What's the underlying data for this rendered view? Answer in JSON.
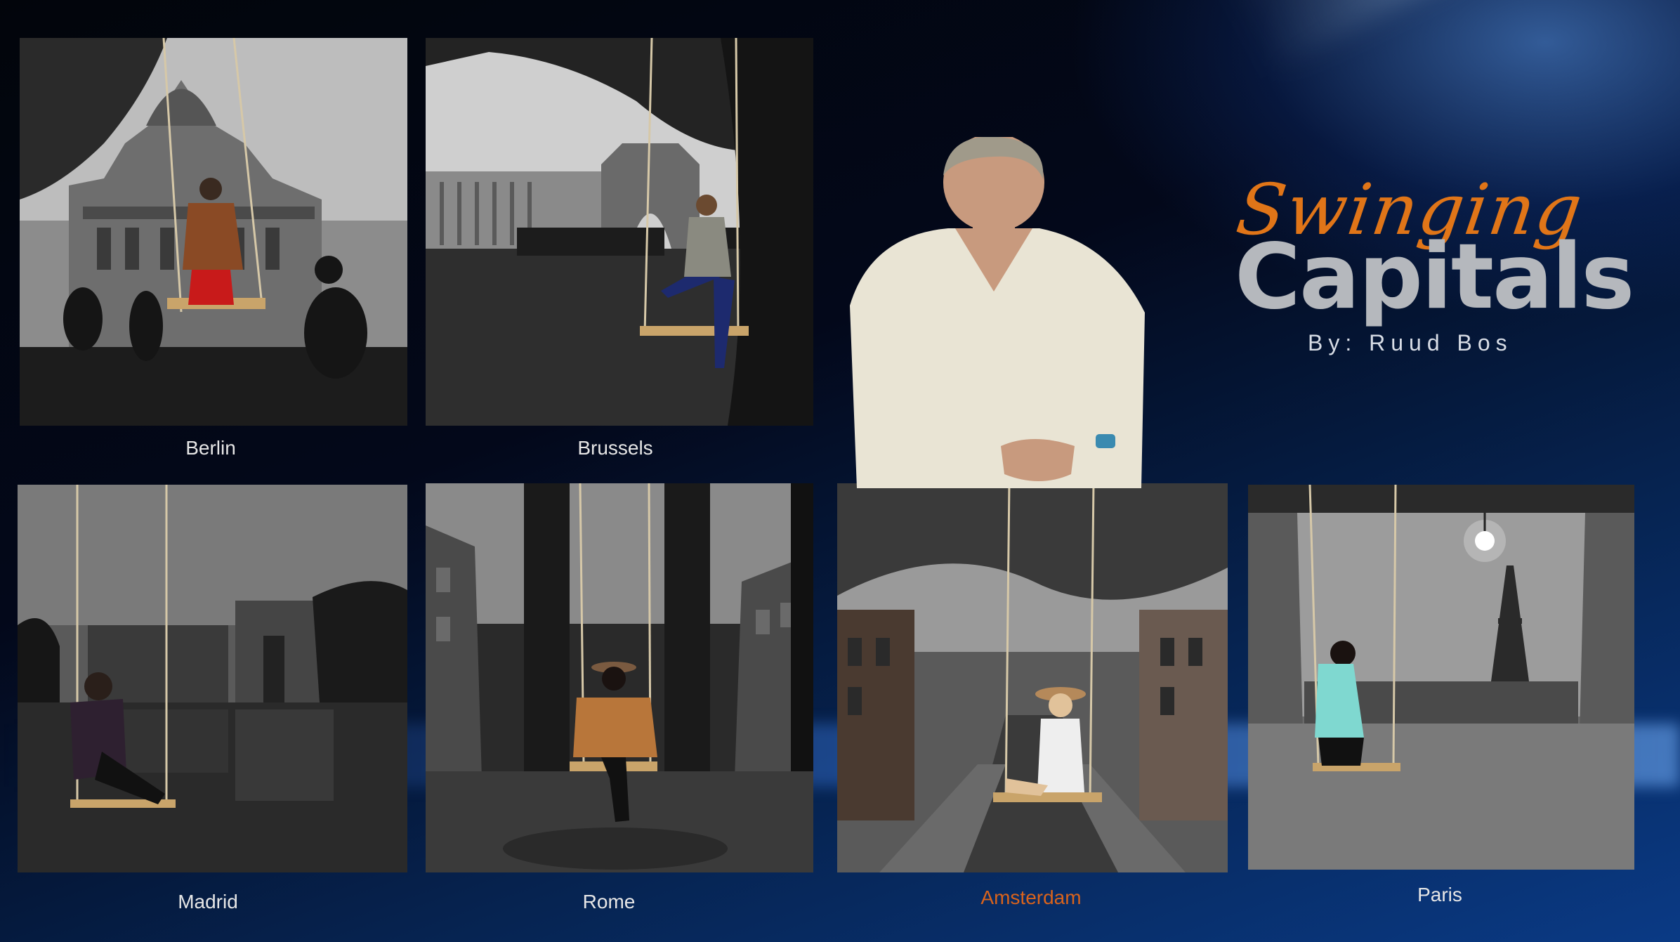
{
  "header": {
    "title_line1": "Swinging",
    "title_line2": "Capitals",
    "byline": "By:  Ruud Bos"
  },
  "gallery": {
    "items": [
      {
        "label": "Berlin"
      },
      {
        "label": "Brussels"
      },
      {
        "label": "Madrid"
      },
      {
        "label": "Rome"
      },
      {
        "label": "Amsterdam"
      },
      {
        "label": "Paris"
      }
    ],
    "selected": "Amsterdam"
  },
  "colors": {
    "accent_orange": "#d9631c",
    "title_grey": "#b5b8bd",
    "background_blue": "#0a3a85"
  }
}
